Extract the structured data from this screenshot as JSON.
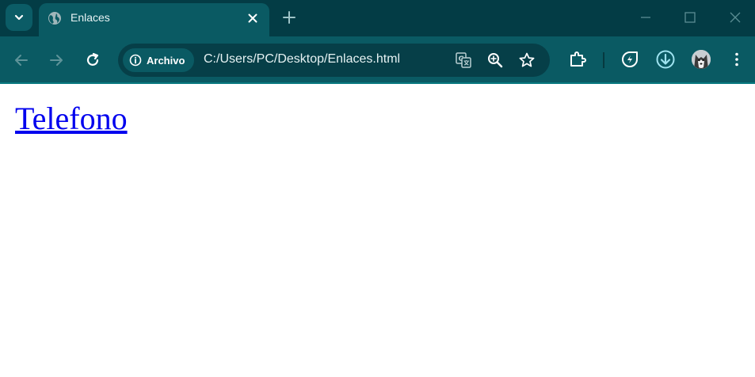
{
  "tab": {
    "title": "Enlaces"
  },
  "omnibox": {
    "chip_label": "Archivo",
    "url": "C:/Users/PC/Desktop/Enlaces.html"
  },
  "page": {
    "link_text": "Telefono"
  },
  "colors": {
    "titlebar": "#033c45",
    "toolbar": "#0a5a63",
    "omnibox": "#063f48",
    "link": "#0000ee"
  },
  "icons": [
    "chevron-down-icon",
    "globe-icon",
    "close-icon",
    "plus-icon",
    "minimize-icon",
    "maximize-icon",
    "window-close-icon",
    "back-arrow-icon",
    "forward-arrow-icon",
    "reload-icon",
    "info-icon",
    "translate-icon",
    "zoom-icon",
    "star-icon",
    "extensions-icon",
    "performance-icon",
    "download-icon",
    "avatar",
    "more-vert-icon"
  ]
}
